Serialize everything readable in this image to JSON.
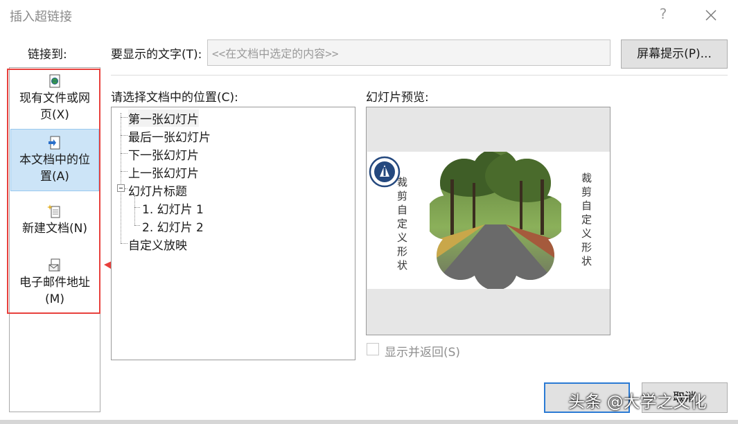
{
  "window": {
    "title": "插入超链接",
    "help_label": "?"
  },
  "nav": {
    "heading": "链接到:",
    "items": [
      {
        "label_line1": "现有文件或网",
        "label_line2": "页(X)"
      },
      {
        "label_line1": "本文档中的位",
        "label_line2": "置(A)",
        "selected": true
      },
      {
        "label_line1": "新建文档(N)",
        "label_line2": ""
      },
      {
        "label_line1": "电子邮件地址",
        "label_line2": "(M)"
      }
    ]
  },
  "display_text": {
    "label": "要显示的文字(T):",
    "value": "<<在文档中选定的内容>>"
  },
  "screentip_button": "屏幕提示(P)...",
  "location": {
    "label": "请选择文档中的位置(C):",
    "nodes": [
      "第一张幻灯片",
      "最后一张幻灯片",
      "下一张幻灯片",
      "上一张幻灯片",
      "幻灯片标题",
      "1. 幻灯片 1",
      "2. 幻灯片 2",
      "自定义放映"
    ]
  },
  "preview": {
    "label": "幻灯片预览:",
    "left_text": "裁剪自定义形状",
    "right_text": "裁剪自定义形状"
  },
  "show_and_return": {
    "label": "显示并返回(S)",
    "checked": false
  },
  "buttons": {
    "ok": "",
    "cancel": "取消"
  },
  "watermark": "头条 @大学之文化",
  "colors": {
    "selection_bg": "#cce4f7",
    "red_annotation": "#e8403c",
    "default_button_border": "#2a7ad4"
  }
}
